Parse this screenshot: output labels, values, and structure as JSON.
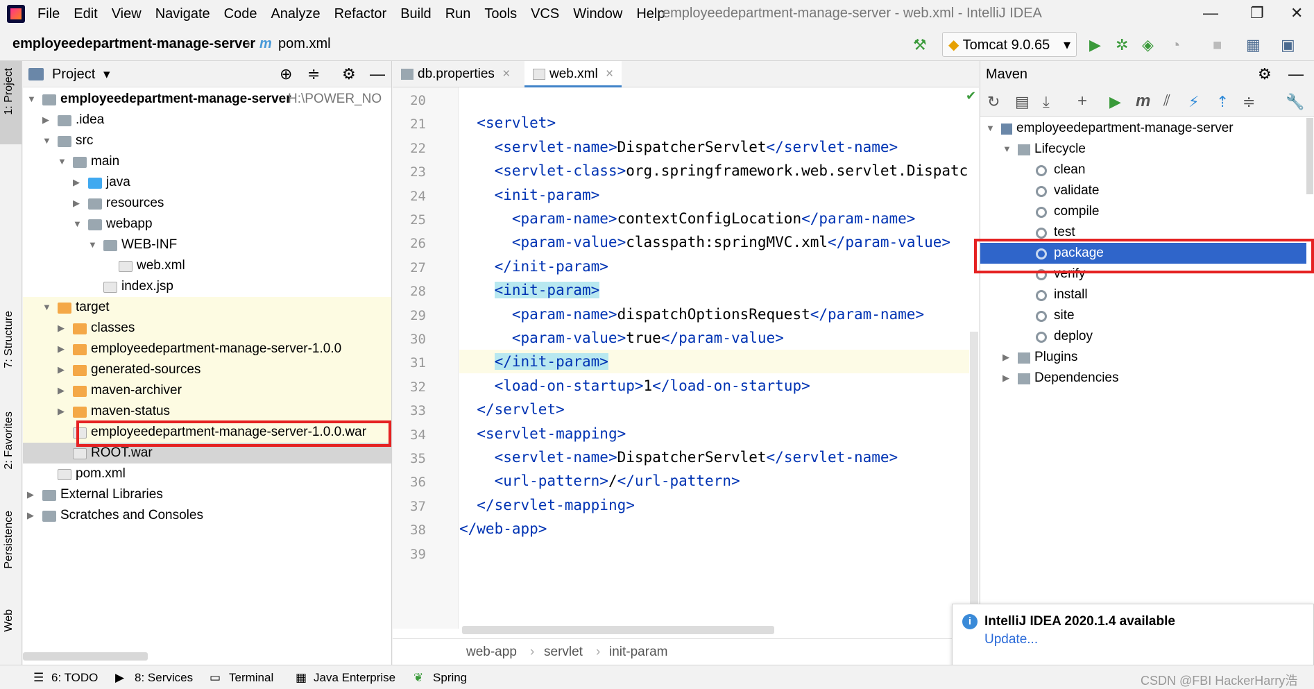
{
  "menubar": {
    "items": [
      "File",
      "Edit",
      "View",
      "Navigate",
      "Code",
      "Analyze",
      "Refactor",
      "Build",
      "Run",
      "Tools",
      "VCS",
      "Window",
      "Help"
    ],
    "window_title": "employeedepartment-manage-server - web.xml - IntelliJ IDEA"
  },
  "navbar": {
    "project": "employeedepartment-manage-server",
    "file": "pom.xml",
    "run_config": "Tomcat 9.0.65"
  },
  "left_strip": {
    "project": "1: Project",
    "structure": "7: Structure",
    "favorites": "2: Favorites",
    "persistence": "Persistence",
    "web": "Web"
  },
  "project_panel": {
    "title": "Project",
    "tree": [
      {
        "label": "employeedepartment-manage-server",
        "extra": "H:\\POWER_NO",
        "depth": 0,
        "arrow": "down",
        "icon": "folder",
        "bold": true
      },
      {
        "label": ".idea",
        "depth": 1,
        "arrow": "right",
        "icon": "folder"
      },
      {
        "label": "src",
        "depth": 1,
        "arrow": "down",
        "icon": "folder"
      },
      {
        "label": "main",
        "depth": 2,
        "arrow": "down",
        "icon": "folder"
      },
      {
        "label": "java",
        "depth": 3,
        "arrow": "right",
        "icon": "folder-blue"
      },
      {
        "label": "resources",
        "depth": 3,
        "arrow": "right",
        "icon": "folder"
      },
      {
        "label": "webapp",
        "depth": 3,
        "arrow": "down",
        "icon": "folder"
      },
      {
        "label": "WEB-INF",
        "depth": 4,
        "arrow": "down",
        "icon": "folder"
      },
      {
        "label": "web.xml",
        "depth": 5,
        "arrow": "",
        "icon": "file"
      },
      {
        "label": "index.jsp",
        "depth": 4,
        "arrow": "",
        "icon": "file"
      },
      {
        "label": "target",
        "depth": 1,
        "arrow": "down",
        "icon": "folder-orange",
        "yellow": true
      },
      {
        "label": "classes",
        "depth": 2,
        "arrow": "right",
        "icon": "folder-orange",
        "yellow": true
      },
      {
        "label": "employeedepartment-manage-server-1.0.0",
        "depth": 2,
        "arrow": "right",
        "icon": "folder-orange",
        "yellow": true
      },
      {
        "label": "generated-sources",
        "depth": 2,
        "arrow": "right",
        "icon": "folder-orange",
        "yellow": true
      },
      {
        "label": "maven-archiver",
        "depth": 2,
        "arrow": "right",
        "icon": "folder-orange",
        "yellow": true
      },
      {
        "label": "maven-status",
        "depth": 2,
        "arrow": "right",
        "icon": "folder-orange",
        "yellow": true
      },
      {
        "label": "employeedepartment-manage-server-1.0.0.war",
        "depth": 2,
        "arrow": "",
        "icon": "file",
        "yellow": true,
        "boxed": true
      },
      {
        "label": "ROOT.war",
        "depth": 2,
        "arrow": "",
        "icon": "file",
        "selected": true
      },
      {
        "label": "pom.xml",
        "depth": 1,
        "arrow": "",
        "icon": "file"
      },
      {
        "label": "External Libraries",
        "depth": 0,
        "arrow": "right",
        "icon": "folder"
      },
      {
        "label": "Scratches and Consoles",
        "depth": 0,
        "arrow": "right",
        "icon": "folder"
      }
    ]
  },
  "editor": {
    "tabs": [
      "db.properties",
      "web.xml"
    ],
    "active_tab": "web.xml",
    "line_numbers": [
      "20",
      "21",
      "22",
      "23",
      "24",
      "25",
      "26",
      "27",
      "28",
      "29",
      "30",
      "31",
      "32",
      "33",
      "34",
      "35",
      "36",
      "37",
      "38",
      "39"
    ],
    "lines": [
      {
        "indent": "",
        "parts": []
      },
      {
        "indent": "  ",
        "parts": [
          [
            "t",
            "<servlet>"
          ]
        ]
      },
      {
        "indent": "    ",
        "parts": [
          [
            "t",
            "<servlet-name>"
          ],
          [
            "x",
            "DispatcherServlet"
          ],
          [
            "t",
            "</servlet-name>"
          ]
        ]
      },
      {
        "indent": "    ",
        "parts": [
          [
            "t",
            "<servlet-class>"
          ],
          [
            "x",
            "org.springframework.web.servlet.DispatcherServlet"
          ]
        ]
      },
      {
        "indent": "    ",
        "parts": [
          [
            "t",
            "<init-param>"
          ]
        ]
      },
      {
        "indent": "      ",
        "parts": [
          [
            "t",
            "<param-name>"
          ],
          [
            "x",
            "contextConfigLocation"
          ],
          [
            "t",
            "</param-name>"
          ]
        ]
      },
      {
        "indent": "      ",
        "parts": [
          [
            "t",
            "<param-value>"
          ],
          [
            "x",
            "classpath:springMVC.xml"
          ],
          [
            "t",
            "</param-value>"
          ]
        ]
      },
      {
        "indent": "    ",
        "parts": [
          [
            "t",
            "</init-param>"
          ]
        ]
      },
      {
        "indent": "    ",
        "parts": [
          [
            "h",
            "<init-param>"
          ]
        ]
      },
      {
        "indent": "      ",
        "parts": [
          [
            "t",
            "<param-name>"
          ],
          [
            "x",
            "dispatchOptionsRequest"
          ],
          [
            "t",
            "</param-name>"
          ]
        ]
      },
      {
        "indent": "      ",
        "parts": [
          [
            "t",
            "<param-value>"
          ],
          [
            "x",
            "true"
          ],
          [
            "t",
            "</param-value>"
          ]
        ]
      },
      {
        "indent": "    ",
        "parts": [
          [
            "h",
            "</init-param>"
          ]
        ],
        "caret": true
      },
      {
        "indent": "    ",
        "parts": [
          [
            "t",
            "<load-on-startup>"
          ],
          [
            "x",
            "1"
          ],
          [
            "t",
            "</load-on-startup>"
          ]
        ]
      },
      {
        "indent": "  ",
        "parts": [
          [
            "t",
            "</servlet>"
          ]
        ]
      },
      {
        "indent": "  ",
        "parts": [
          [
            "t",
            "<servlet-mapping>"
          ]
        ]
      },
      {
        "indent": "    ",
        "parts": [
          [
            "t",
            "<servlet-name>"
          ],
          [
            "x",
            "DispatcherServlet"
          ],
          [
            "t",
            "</servlet-name>"
          ]
        ]
      },
      {
        "indent": "    ",
        "parts": [
          [
            "t",
            "<url-pattern>"
          ],
          [
            "x",
            "/"
          ],
          [
            "t",
            "</url-pattern>"
          ]
        ]
      },
      {
        "indent": "  ",
        "parts": [
          [
            "t",
            "</servlet-mapping>"
          ]
        ]
      },
      {
        "indent": "",
        "parts": [
          [
            "t",
            "</web-app>"
          ]
        ]
      },
      {
        "indent": "",
        "parts": []
      }
    ],
    "breadcrumb": [
      "web-app",
      "servlet",
      "init-param"
    ]
  },
  "maven": {
    "title": "Maven",
    "project": "employeedepartment-manage-server",
    "lifecycle_label": "Lifecycle",
    "lifecycle": [
      "clean",
      "validate",
      "compile",
      "test",
      "package",
      "verify",
      "install",
      "site",
      "deploy"
    ],
    "selected": "package",
    "plugins": "Plugins",
    "dependencies": "Dependencies"
  },
  "notification": {
    "title": "IntelliJ IDEA 2020.1.4 available",
    "link": "Update..."
  },
  "statusbar": {
    "items": [
      "6: TODO",
      "8: Services",
      "Terminal",
      "Java Enterprise",
      "Spring"
    ],
    "watermark": "CSDN @FBI HackerHarry浩"
  },
  "colors": {
    "selection": "#2f65ca",
    "highlight_box": "#e52222",
    "tag": "#0033b3",
    "yellow_row": "#fdfbe2"
  }
}
